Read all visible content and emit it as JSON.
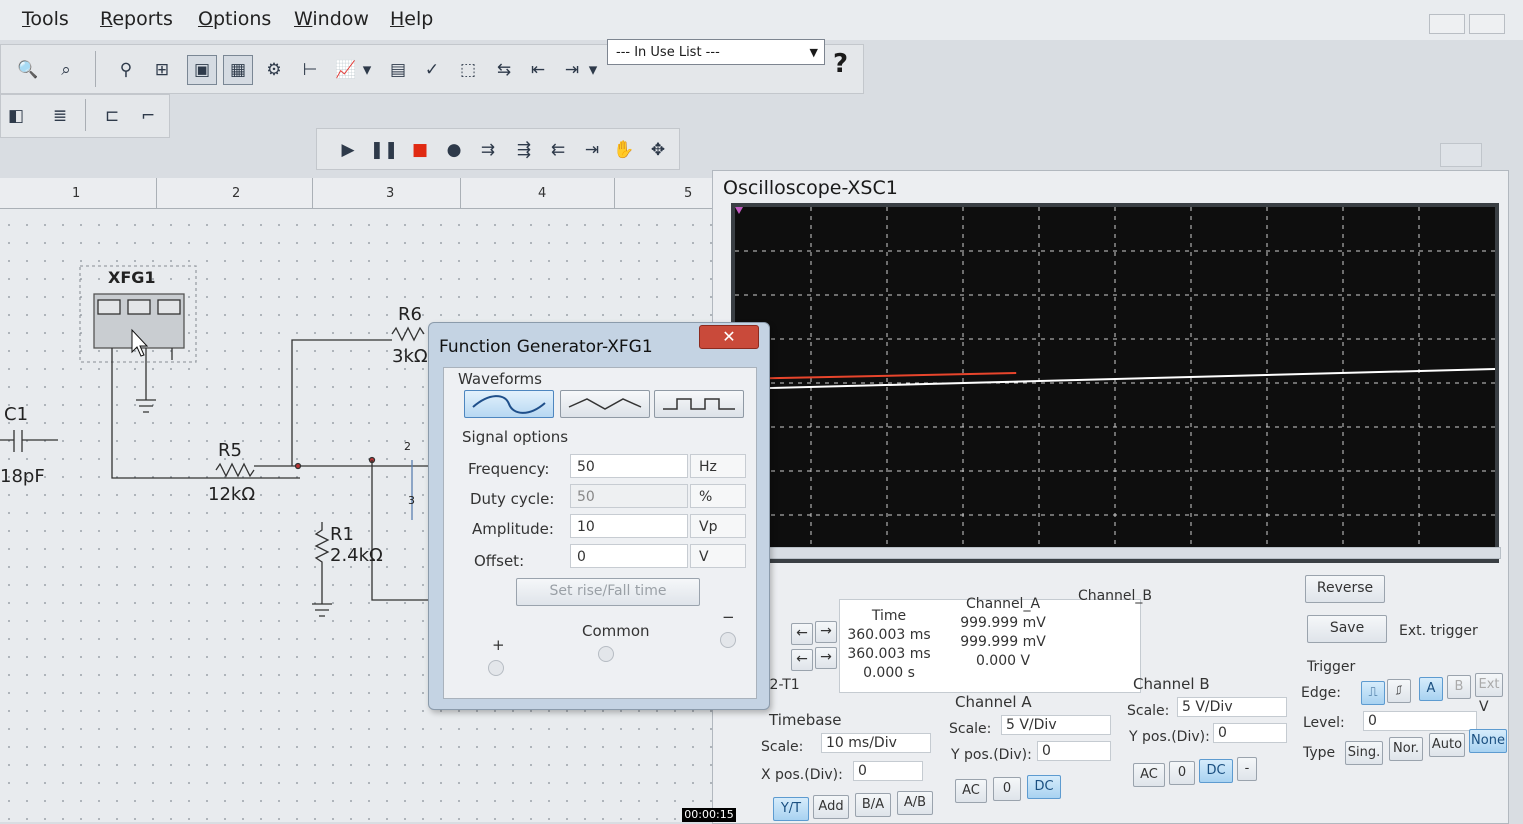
{
  "menu": [
    "Tools",
    "Reports",
    "Options",
    "Window",
    "Help"
  ],
  "toolbar": {
    "in_use_list": "--- In Use List ---",
    "help": "?"
  },
  "ruler": [
    "1",
    "2",
    "3",
    "4",
    "5"
  ],
  "schematic": {
    "xfg_label": "XFG1",
    "c1_name": "C1",
    "c1_value": "18pF",
    "r5_name": "R5",
    "r5_value": "12kΩ",
    "r6_name": "R6",
    "r6_value": "3kΩ",
    "r1_name": "R1",
    "r1_value": "2.4kΩ",
    "node2": "2",
    "node3": "3"
  },
  "function_generator": {
    "title": "Function Generator-XFG1",
    "close": "✕",
    "waveforms_label": "Waveforms",
    "selected_waveform": "sine",
    "signal_options_label": "Signal options",
    "frequency_label": "Frequency:",
    "frequency_value": "50",
    "frequency_unit": "Hz",
    "duty_label": "Duty cycle:",
    "duty_value": "50",
    "duty_unit": "%",
    "amplitude_label": "Amplitude:",
    "amplitude_value": "10",
    "amplitude_unit": "Vp",
    "offset_label": "Offset:",
    "offset_value": "0",
    "offset_unit": "V",
    "rise_fall_button": "Set rise/Fall time",
    "plus": "+",
    "common": "Common",
    "minus": "−"
  },
  "oscilloscope": {
    "title": "Oscilloscope-XSC1",
    "time_header": "Time",
    "channel_a_header": "Channel_A",
    "channel_b_header": "Channel_B",
    "t1_time": "360.003 ms",
    "t2_time": "360.003 ms",
    "dt_time": "0.000 s",
    "t1_a": "999.999 mV",
    "t2_a": "999.999 mV",
    "dt_a": "0.000 V",
    "t2t1": "T2-T1",
    "reverse_button": "Reverse",
    "save_button": "Save",
    "ext_trigger": "Ext. trigger",
    "timebase_label": "Timebase",
    "tb_scale_label": "Scale:",
    "tb_scale_value": "10 ms/Div",
    "xpos_label": "X pos.(Div):",
    "xpos_value": "0",
    "mode_buttons": [
      "Y/T",
      "Add",
      "B/A",
      "A/B"
    ],
    "cha_label": "Channel A",
    "cha_scale_label": "Scale:",
    "cha_scale_value": "5 V/Div",
    "cha_ypos_label": "Y pos.(Div):",
    "cha_ypos_value": "0",
    "cha_coupling": [
      "AC",
      "0",
      "DC"
    ],
    "chb_label": "Channel B",
    "chb_scale_label": "Scale:",
    "chb_scale_value": "5 V/Div",
    "chb_ypos_label": "Y pos.(Div):",
    "chb_ypos_value": "0",
    "chb_coupling": [
      "AC",
      "0",
      "DC",
      "-"
    ],
    "trigger_label": "Trigger",
    "edge_label": "Edge:",
    "level_label": "Level:",
    "level_value": "0",
    "level_unit": "V",
    "type_label": "Type",
    "type_buttons": [
      "Sing.",
      "Nor.",
      "Auto",
      "None"
    ],
    "trigger_source": [
      "A",
      "B",
      "Ext"
    ],
    "trace_color_a": "#e8452c",
    "trace_color_b": "#ffffff"
  },
  "timestamp": "00:00:15"
}
